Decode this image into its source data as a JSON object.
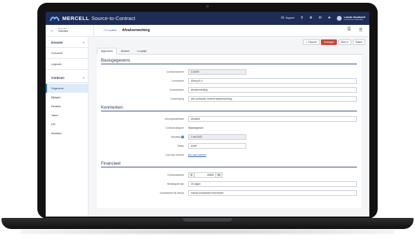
{
  "app": {
    "brand": "MERCELL",
    "product": "Source-to-Contract"
  },
  "topbar": {
    "support_label": "Support",
    "user_name": "Laszlo Goudsmit",
    "user_org": "Gemeente Amsterdam"
  },
  "subheader": {
    "back_small": "Terug naar",
    "back_big": "Overzicht",
    "crumb_link": "IT-Facilities",
    "crumb_current": "Afvalverwerking"
  },
  "sidebar": {
    "dossier_title": "Dossier",
    "dossier_items": [
      {
        "label": "Overzicht"
      },
      {
        "label": "Logboek"
      }
    ],
    "contract_title": "Contract",
    "contract_items": [
      {
        "label": "Gegevens"
      },
      {
        "label": "Bijlagen"
      },
      {
        "label": "Relaties"
      },
      {
        "label": "Taken"
      },
      {
        "label": "KPI"
      },
      {
        "label": "Mutaties"
      }
    ]
  },
  "actions": {
    "archive": "Favoriet",
    "extend": "Verlengen",
    "more": "Meer",
    "close": "Sluiten"
  },
  "tabs": [
    {
      "label": "Algemeen"
    },
    {
      "label": "Beheer"
    },
    {
      "label": "Looptijd"
    }
  ],
  "sections": {
    "basis_title": "Basisgegevens",
    "kenmerken_title": "Kenmerken",
    "financieel_title": "Financieel"
  },
  "basis": [
    {
      "label": "Contractnummer",
      "value": "C10009"
    },
    {
      "label": "Leverancier",
      "value": "Allsorg B.V."
    },
    {
      "label": "Contractnaam",
      "value": "Afvalverwerking"
    },
    {
      "label": "Omschrijving",
      "value": "Alle contracten omtrent afvalverwerking"
    }
  ],
  "kenmerken": [
    {
      "label": "Inkoopclassificatie",
      "value": "Afvalstof"
    },
    {
      "label": "Contractcategorie",
      "value": "Waardegericht"
    },
    {
      "label": "Afsluiting",
      "value": "1-okt-2022"
    },
    {
      "label": "Status",
      "value": "Actief"
    },
    {
      "label": "Link naar contract",
      "value": "link naar contract"
    }
  ],
  "financieel": {
    "contractwaarde_label": "Contractwaarde",
    "currency": "€",
    "amount": "10000",
    "decimals": "00",
    "betaaltermijn_label": "Betalingstermijn",
    "betaaltermijn_value": "30 dagen",
    "voorwaarden_label": "Voorwaarden bij inkoop",
    "voorwaarden_value": "Inkoopvoorwaarden leverancier"
  },
  "colors": {
    "topbar": "#1f2c55",
    "accent": "#2a78c4",
    "primary_action": "#c8493a"
  }
}
